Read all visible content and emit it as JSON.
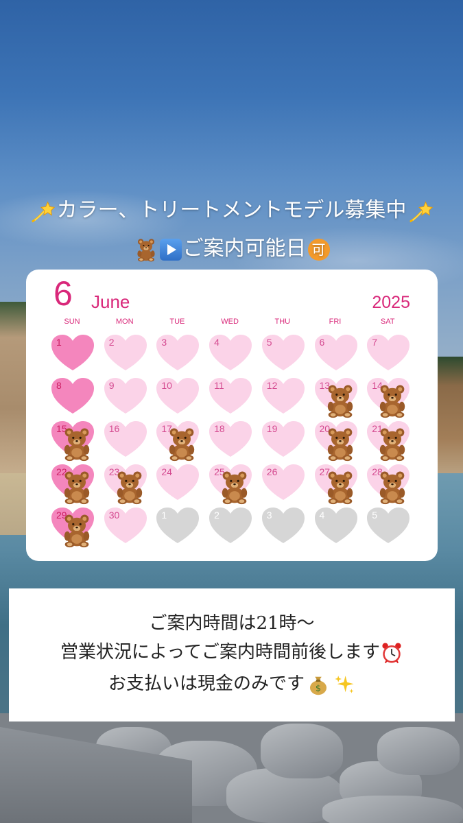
{
  "headline": {
    "line1_text": "カラー、トリートメントモデル募集中",
    "line1_left_icon": "dizzy-comet-icon",
    "line1_right_icon": "dizzy-comet-icon",
    "line2_text": "ご案内可能日",
    "line2_icons": [
      "teddy-bear-icon",
      "play-button-icon"
    ],
    "line2_badge": "可"
  },
  "calendar": {
    "month_number": "6",
    "month_name": "June",
    "year": "2025",
    "weekdays": [
      "SUN",
      "MON",
      "TUE",
      "WED",
      "THU",
      "FRI",
      "SAT"
    ],
    "colors": {
      "accent": "#d9287a",
      "sunday_heart": "#f486bd",
      "day_heart": "#fbd3e8",
      "outside_heart": "#d6d6d6"
    },
    "legend_icon": "teddy-bear-icon",
    "weeks": [
      [
        {
          "day": "1",
          "type": "sunday",
          "available": false
        },
        {
          "day": "2",
          "type": "day",
          "available": false
        },
        {
          "day": "3",
          "type": "day",
          "available": false
        },
        {
          "day": "4",
          "type": "day",
          "available": false
        },
        {
          "day": "5",
          "type": "day",
          "available": false
        },
        {
          "day": "6",
          "type": "day",
          "available": false
        },
        {
          "day": "7",
          "type": "day",
          "available": false
        }
      ],
      [
        {
          "day": "8",
          "type": "sunday",
          "available": false
        },
        {
          "day": "9",
          "type": "day",
          "available": false
        },
        {
          "day": "10",
          "type": "day",
          "available": false
        },
        {
          "day": "11",
          "type": "day",
          "available": false
        },
        {
          "day": "12",
          "type": "day",
          "available": false
        },
        {
          "day": "13",
          "type": "day",
          "available": true
        },
        {
          "day": "14",
          "type": "day",
          "available": true
        }
      ],
      [
        {
          "day": "15",
          "type": "sunday",
          "available": true
        },
        {
          "day": "16",
          "type": "day",
          "available": false
        },
        {
          "day": "17",
          "type": "day",
          "available": true
        },
        {
          "day": "18",
          "type": "day",
          "available": false
        },
        {
          "day": "19",
          "type": "day",
          "available": false
        },
        {
          "day": "20",
          "type": "day",
          "available": true
        },
        {
          "day": "21",
          "type": "day",
          "available": true
        }
      ],
      [
        {
          "day": "22",
          "type": "sunday",
          "available": true
        },
        {
          "day": "23",
          "type": "day",
          "available": true
        },
        {
          "day": "24",
          "type": "day",
          "available": false
        },
        {
          "day": "25",
          "type": "day",
          "available": true
        },
        {
          "day": "26",
          "type": "day",
          "available": false
        },
        {
          "day": "27",
          "type": "day",
          "available": true
        },
        {
          "day": "28",
          "type": "day",
          "available": true
        }
      ],
      [
        {
          "day": "29",
          "type": "sunday",
          "available": true
        },
        {
          "day": "30",
          "type": "day",
          "available": false
        },
        {
          "day": "1",
          "type": "outside",
          "available": false
        },
        {
          "day": "2",
          "type": "outside",
          "available": false
        },
        {
          "day": "3",
          "type": "outside",
          "available": false
        },
        {
          "day": "4",
          "type": "outside",
          "available": false
        },
        {
          "day": "5",
          "type": "outside",
          "available": false
        }
      ]
    ]
  },
  "info": {
    "line1": "ご案内時間は21時〜",
    "line2": "営業状況によってご案内時間前後します",
    "line2_icon": "alarm-clock-icon",
    "line3": "お支払いは現金のみです",
    "line3_icons": [
      "money-bag-icon",
      "sparkles-icon"
    ]
  }
}
